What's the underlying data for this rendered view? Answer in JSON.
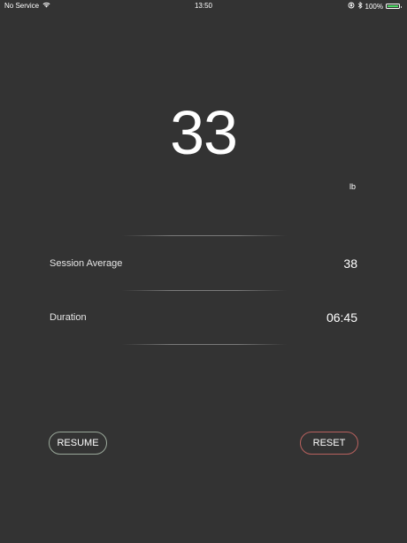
{
  "status_bar": {
    "carrier": "No Service",
    "time": "13:50",
    "battery_percent": "100%",
    "battery_level": 1.0,
    "battery_color": "#4cd964",
    "icons": [
      "wifi-icon",
      "orientation-lock-icon",
      "bluetooth-icon",
      "battery-icon"
    ]
  },
  "reading": {
    "value": "33",
    "unit": "lb"
  },
  "stats": [
    {
      "label": "Session Average",
      "value": "38"
    },
    {
      "label": "Duration",
      "value": "06:45"
    }
  ],
  "buttons": {
    "resume_label": "RESUME",
    "reset_label": "RESET",
    "resume_border_color": "#9aa89a",
    "reset_border_color": "#b8615e"
  },
  "colors": {
    "background": "#333333",
    "text": "#ffffff"
  }
}
